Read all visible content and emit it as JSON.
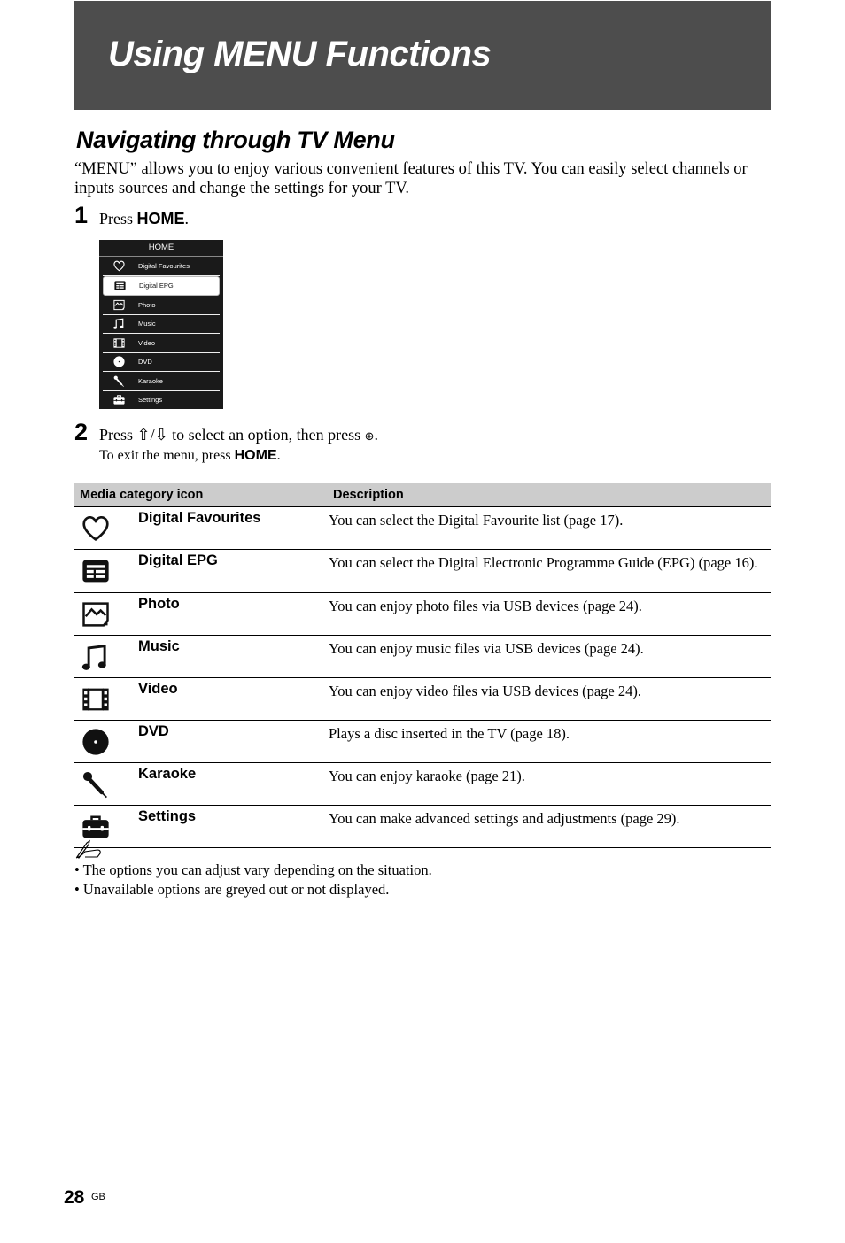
{
  "header": {
    "title": "Using MENU Functions"
  },
  "section": {
    "title": "Navigating through TV Menu",
    "intro": "“MENU” allows you to enjoy various convenient features of this TV. You can easily select channels or inputs sources and change the settings for your TV."
  },
  "steps": [
    {
      "number": "1",
      "prefix": "Press ",
      "key": "HOME",
      "suffix": "."
    },
    {
      "number": "2",
      "prefix": "Press ⇧/⇩ to select an option, then press ",
      "enter_symbol": "⊕",
      "suffix": ".",
      "sub_prefix": "To exit the menu, press ",
      "sub_key": "HOME",
      "sub_suffix": "."
    }
  ],
  "tv_menu": {
    "header": "HOME",
    "selected_index": 1,
    "items": [
      {
        "label": "Digital Favourites",
        "icon": "heart-icon"
      },
      {
        "label": "Digital EPG",
        "icon": "epg-grid-icon"
      },
      {
        "label": "Photo",
        "icon": "photo-icon"
      },
      {
        "label": "Music",
        "icon": "music-note-icon"
      },
      {
        "label": "Video",
        "icon": "film-icon"
      },
      {
        "label": "DVD",
        "icon": "disc-icon"
      },
      {
        "label": "Karaoke",
        "icon": "microphone-icon"
      },
      {
        "label": "Settings",
        "icon": "toolbox-icon"
      }
    ]
  },
  "table": {
    "headers": [
      "Media category icon",
      "Description"
    ],
    "rows": [
      {
        "icon": "heart-icon",
        "name": "Digital Favourites",
        "description": "You can select the Digital Favourite list (page 17)."
      },
      {
        "icon": "epg-grid-icon",
        "name": "Digital EPG",
        "description": "You can select the Digital Electronic Programme Guide (EPG) (page 16)."
      },
      {
        "icon": "photo-icon",
        "name": "Photo",
        "description": "You can enjoy photo files via USB devices (page 24)."
      },
      {
        "icon": "music-note-icon",
        "name": "Music",
        "description": "You can enjoy music files via USB devices (page 24)."
      },
      {
        "icon": "film-icon",
        "name": "Video",
        "description": "You can enjoy video files via USB devices (page 24)."
      },
      {
        "icon": "disc-icon",
        "name": "DVD",
        "description": "Plays a disc inserted in the TV (page 18)."
      },
      {
        "icon": "microphone-icon",
        "name": "Karaoke",
        "description": "You can enjoy karaoke (page 21)."
      },
      {
        "icon": "toolbox-icon",
        "name": "Settings",
        "description": "You can make advanced settings and adjustments (page 29)."
      }
    ]
  },
  "notes": {
    "icon": "note-pencil-icon",
    "items": [
      "• The options you can adjust vary depending on the situation.",
      "• Unavailable options are greyed out or not displayed."
    ]
  },
  "footer": {
    "page_number": "28",
    "region": "GB"
  },
  "colors": {
    "banner_bg": "#4d4d4d",
    "table_header_bg": "#cccccc",
    "menu_bg": "#1a1a1a"
  }
}
